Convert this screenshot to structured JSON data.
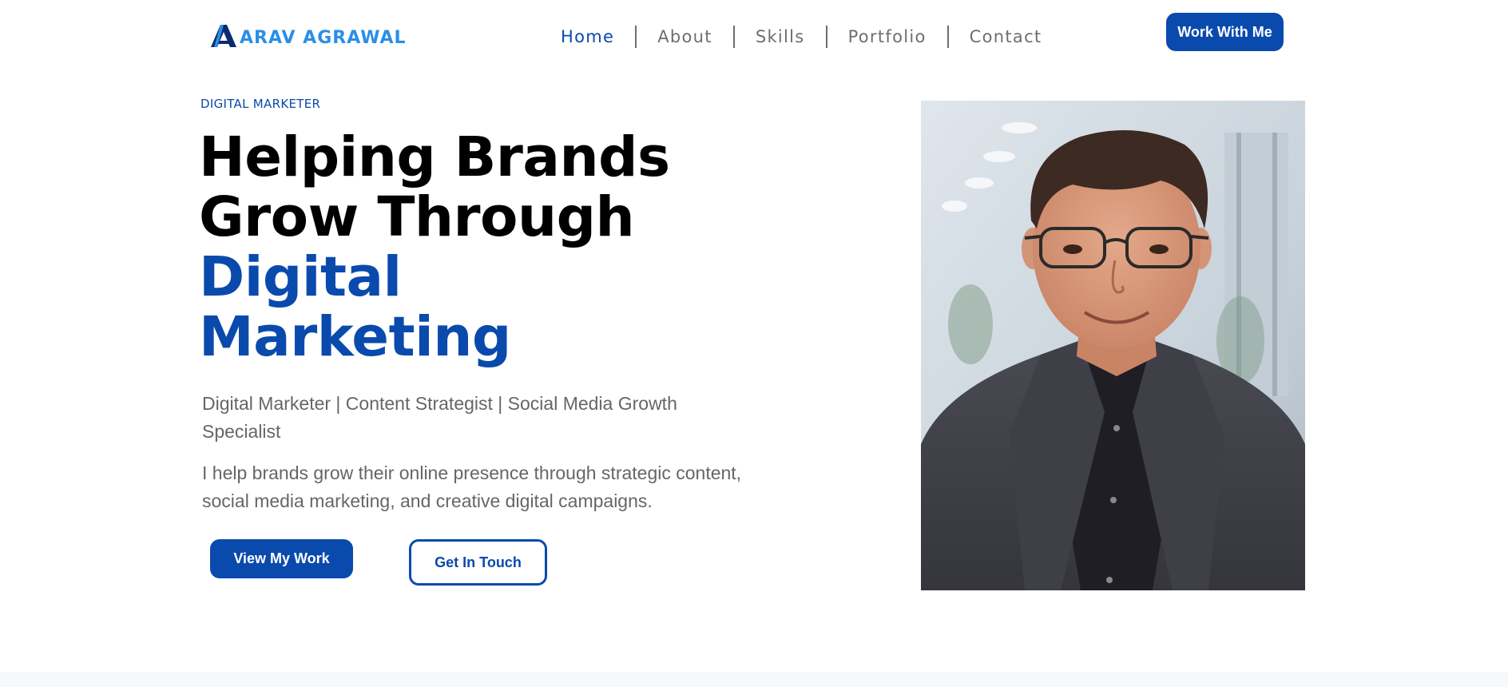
{
  "header": {
    "logo_text": "ARAV AGRAWAL",
    "nav": [
      {
        "label": "Home",
        "active": true
      },
      {
        "label": "About",
        "active": false
      },
      {
        "label": "Skills",
        "active": false
      },
      {
        "label": "Portfolio",
        "active": false
      },
      {
        "label": "Contact",
        "active": false
      }
    ],
    "cta_label": "Work With Me"
  },
  "hero": {
    "eyebrow": "DIGITAL MARKETER",
    "headline_line1": "Helping Brands",
    "headline_line2": "Grow Through",
    "headline_accent_line1": "Digital",
    "headline_accent_line2": "Marketing",
    "subtitle": "Digital Marketer | Content Strategist | Social Media Growth Specialist",
    "description": "I help brands grow their online presence through strategic content, social media marketing, and creative digital campaigns.",
    "primary_button": "View My Work",
    "secondary_button": "Get In Touch"
  },
  "colors": {
    "accent": "#0a4aad",
    "logo": "#2a8ee8",
    "nav_text": "#6e6e6e",
    "body_text": "#666666",
    "heading": "#000000"
  },
  "icons": {
    "logo_mark": "letter-a-logo-icon"
  }
}
